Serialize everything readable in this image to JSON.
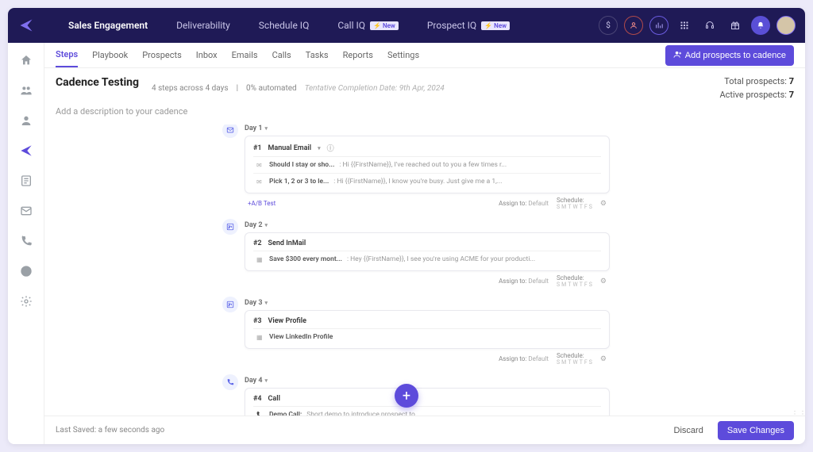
{
  "topnav": {
    "items": [
      "Sales Engagement",
      "Deliverability",
      "Schedule IQ",
      "Call IQ",
      "Prospect IQ"
    ],
    "new_badge": "New"
  },
  "subnav": {
    "tabs": [
      "Steps",
      "Playbook",
      "Prospects",
      "Inbox",
      "Emails",
      "Calls",
      "Tasks",
      "Reports",
      "Settings"
    ],
    "add_prospects": "Add prospects to cadence"
  },
  "header": {
    "title": "Cadence Testing",
    "meta_steps": "4 steps across 4 days",
    "meta_automated": "0% automated",
    "tentative": "Tentative Completion Date: 9th Apr, 2024",
    "description_placeholder": "Add a description to your cadence",
    "total_label": "Total prospects:",
    "total_value": "7",
    "active_label": "Active prospects:",
    "active_value": "7"
  },
  "steps": [
    {
      "day": "Day 1",
      "icon": "mail",
      "num": "#1",
      "title": "Manual Email",
      "items": [
        {
          "subject": "Should I stay or sho...",
          "preview": ": Hi {{FirstName}}, I've reached out to you a few times r..."
        },
        {
          "subject": "Pick 1, 2 or 3 to le...",
          "preview": ": Hi {{FirstName}}, I know you're busy. Just give me a 1,..."
        }
      ],
      "ab": "+A/B Test"
    },
    {
      "day": "Day 2",
      "icon": "linkedin",
      "num": "#2",
      "title": "Send InMail",
      "items": [
        {
          "subject": "Save $300 every mont...",
          "preview": ": Hey {{FirstName}}, I see you're using ACME for your producti..."
        }
      ]
    },
    {
      "day": "Day 3",
      "icon": "linkedin",
      "num": "#3",
      "title": "View Profile",
      "items": [
        {
          "subject": "View LinkedIn Profile",
          "preview": ""
        }
      ]
    },
    {
      "day": "Day 4",
      "icon": "call",
      "num": "#4",
      "title": "Call",
      "items": [
        {
          "subject": "Demo Call:",
          "preview": " Short demo to introduce prospect to..."
        }
      ]
    }
  ],
  "footer_labels": {
    "assign": "Assign to:",
    "assign_val": "Default",
    "schedule": "Schedule:",
    "days": [
      "S",
      "M",
      "T",
      "W",
      "T",
      "F",
      "S"
    ]
  },
  "bottom": {
    "saved": "Last Saved: a few seconds ago",
    "discard": "Discard",
    "save": "Save Changes"
  }
}
